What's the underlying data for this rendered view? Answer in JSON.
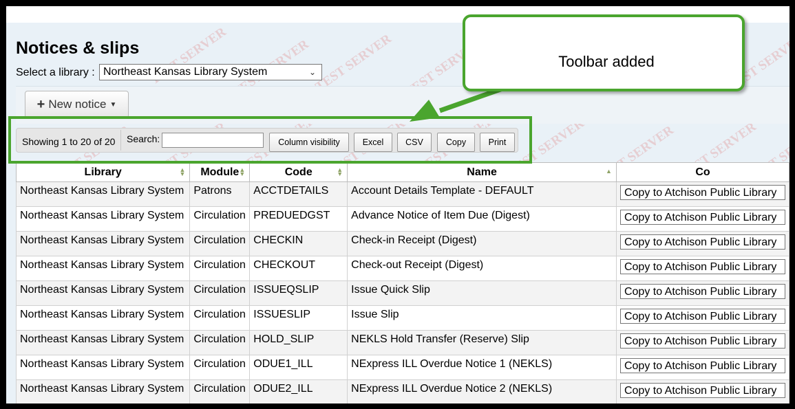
{
  "page": {
    "title": "Notices & slips",
    "library_label": "Select a library :",
    "library_selected": "Northeast Kansas Library System",
    "new_notice_label": "New notice",
    "watermark": "TEST SERVER"
  },
  "toolbar": {
    "info": "Showing 1 to 20 of 20",
    "search_label": "Search:",
    "search_value": "",
    "buttons": [
      "Column visibility",
      "Excel",
      "CSV",
      "Copy",
      "Print"
    ]
  },
  "callout": {
    "text": "Toolbar added"
  },
  "table": {
    "headers": [
      "Library",
      "Module",
      "Code",
      "Name",
      "Co"
    ],
    "rows": [
      {
        "library": "Northeast Kansas Library System",
        "module": "Patrons",
        "code": "ACCTDETAILS",
        "name": "Account Details Template - DEFAULT",
        "copy": "Copy to Atchison Public Library"
      },
      {
        "library": "Northeast Kansas Library System",
        "module": "Circulation",
        "code": "PREDUEDGST",
        "name": "Advance Notice of Item Due (Digest)",
        "copy": "Copy to Atchison Public Library"
      },
      {
        "library": "Northeast Kansas Library System",
        "module": "Circulation",
        "code": "CHECKIN",
        "name": "Check-in Receipt (Digest)",
        "copy": "Copy to Atchison Public Library"
      },
      {
        "library": "Northeast Kansas Library System",
        "module": "Circulation",
        "code": "CHECKOUT",
        "name": "Check-out Receipt (Digest)",
        "copy": "Copy to Atchison Public Library"
      },
      {
        "library": "Northeast Kansas Library System",
        "module": "Circulation",
        "code": "ISSUEQSLIP",
        "name": "Issue Quick Slip",
        "copy": "Copy to Atchison Public Library"
      },
      {
        "library": "Northeast Kansas Library System",
        "module": "Circulation",
        "code": "ISSUESLIP",
        "name": "Issue Slip",
        "copy": "Copy to Atchison Public Library"
      },
      {
        "library": "Northeast Kansas Library System",
        "module": "Circulation",
        "code": "HOLD_SLIP",
        "name": "NEKLS Hold Transfer (Reserve) Slip",
        "copy": "Copy to Atchison Public Library"
      },
      {
        "library": "Northeast Kansas Library System",
        "module": "Circulation",
        "code": "ODUE1_ILL",
        "name": "NExpress ILL Overdue Notice 1 (NEKLS)",
        "copy": "Copy to Atchison Public Library"
      },
      {
        "library": "Northeast Kansas Library System",
        "module": "Circulation",
        "code": "ODUE2_ILL",
        "name": "NExpress ILL Overdue Notice 2 (NEKLS)",
        "copy": "Copy to Atchison Public Library"
      }
    ]
  },
  "colors": {
    "annotation_green": "#4aa52e",
    "page_background": "#e9f1f7",
    "watermark": "#dc5050"
  }
}
